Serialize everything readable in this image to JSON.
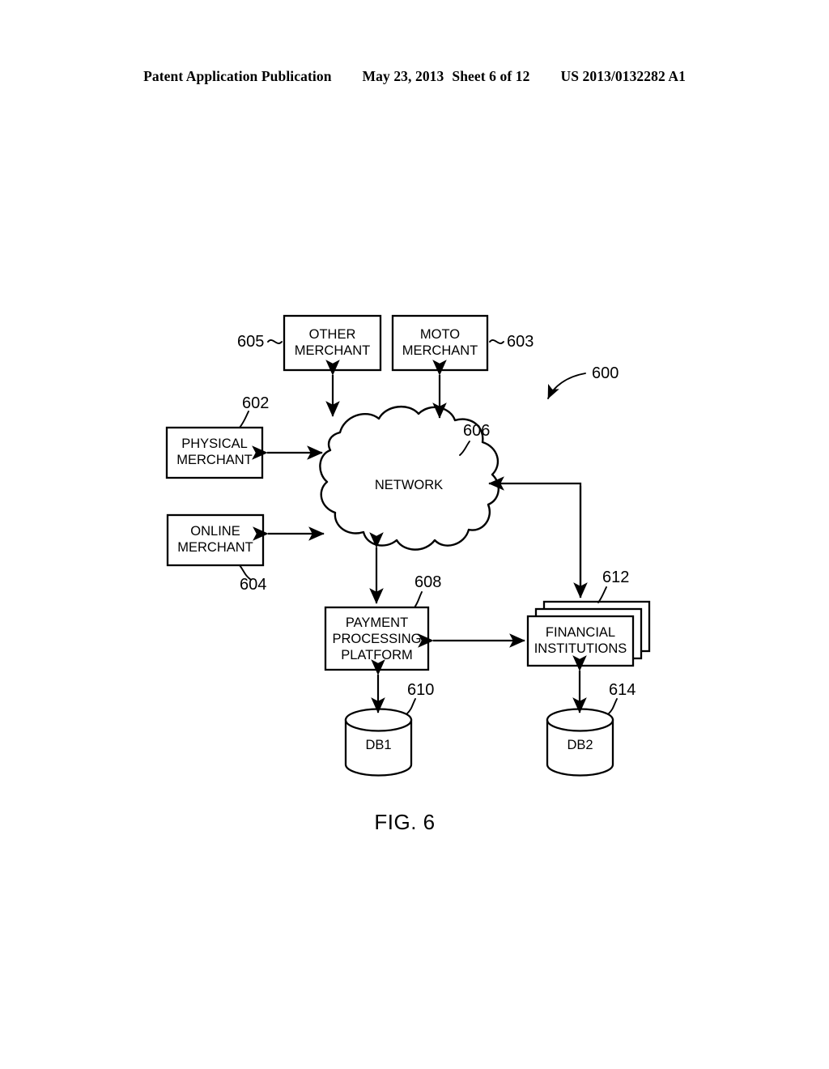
{
  "header": {
    "publication": "Patent Application Publication",
    "date": "May 23, 2013",
    "sheet": "Sheet 6 of 12",
    "patent_number": "US 2013/0132282 A1"
  },
  "figure": {
    "caption": "FIG. 6",
    "system_ref": "600"
  },
  "nodes": {
    "other_merchant": {
      "label": "OTHER\nMERCHANT",
      "ref": "605"
    },
    "moto_merchant": {
      "label": "MOTO\nMERCHANT",
      "ref": "603"
    },
    "physical_merchant": {
      "label": "PHYSICAL\nMERCHANT",
      "ref": "602"
    },
    "online_merchant": {
      "label": "ONLINE\nMERCHANT",
      "ref": "604"
    },
    "network": {
      "label": "NETWORK",
      "ref": "606"
    },
    "payment_processing_platform": {
      "label": "PAYMENT\nPROCESSING\nPLATFORM",
      "ref": "608"
    },
    "financial_institutions": {
      "label": "FINANCIAL\nINSTITUTIONS",
      "ref": "612"
    },
    "db1": {
      "label": "DB1",
      "ref": "610"
    },
    "db2": {
      "label": "DB2",
      "ref": "614"
    }
  },
  "connections": [
    {
      "from": "network",
      "to": "other_merchant",
      "style": "bidirectional"
    },
    {
      "from": "network",
      "to": "moto_merchant",
      "style": "bidirectional"
    },
    {
      "from": "physical_merchant",
      "to": "network",
      "style": "bidirectional"
    },
    {
      "from": "online_merchant",
      "to": "network",
      "style": "bidirectional"
    },
    {
      "from": "network",
      "to": "payment_processing_platform",
      "style": "bidirectional"
    },
    {
      "from": "financial_institutions",
      "to": "network",
      "style": "routed-into-network"
    },
    {
      "from": "payment_processing_platform",
      "to": "financial_institutions",
      "style": "bidirectional"
    },
    {
      "from": "payment_processing_platform",
      "to": "db1",
      "style": "bidirectional"
    },
    {
      "from": "financial_institutions",
      "to": "db2",
      "style": "bidirectional"
    }
  ],
  "colors": {
    "ink": "#000000",
    "paper": "#ffffff"
  }
}
